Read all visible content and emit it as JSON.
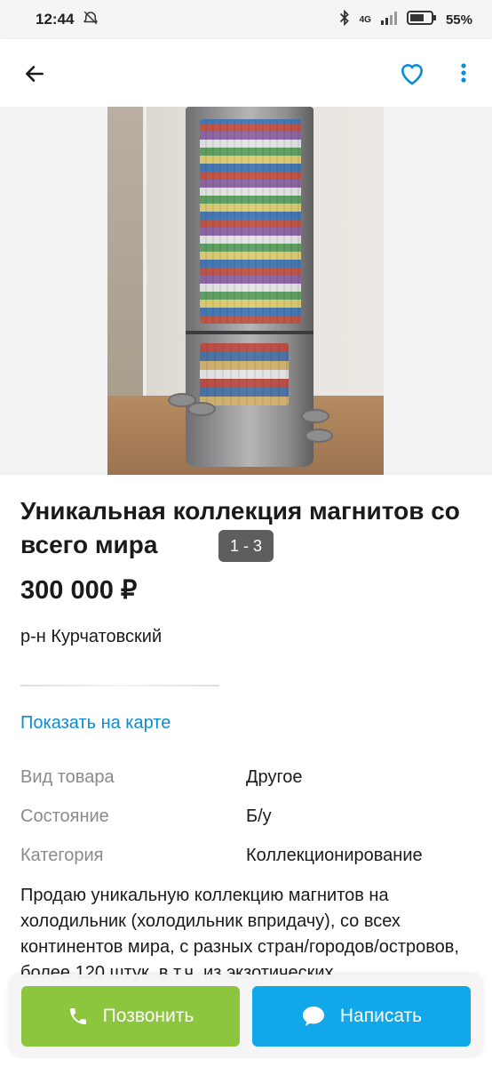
{
  "status_bar": {
    "time": "12:44",
    "network": "4G",
    "battery": "55%"
  },
  "appbar": {
    "back_icon": "arrow-left-icon",
    "favorite_icon": "heart-icon",
    "more_icon": "more-vert-icon"
  },
  "gallery": {
    "counter": "1 - 3"
  },
  "listing": {
    "title": "Уникальная коллекция магнитов со всего мира",
    "price": "300 000 ₽",
    "district": "р-н Курчатовский",
    "map_link": "Показать на карте"
  },
  "params": [
    {
      "label": "Вид товара",
      "value": "Другое"
    },
    {
      "label": "Состояние",
      "value": "Б/у"
    },
    {
      "label": "Категория",
      "value": "Коллекционирование"
    }
  ],
  "description": "Продаю уникальную коллекцию магнитов на холодильник (холодильник впридачу), со всех континентов мира, с разных стран/городов/островов, более 120 штук, в т.ч. из экзотических",
  "actions": {
    "call": "Позвонить",
    "message": "Написать"
  },
  "colors": {
    "call_green": "#8cc63f",
    "message_blue": "#12a7e8",
    "link_blue": "#0b8cd9"
  }
}
